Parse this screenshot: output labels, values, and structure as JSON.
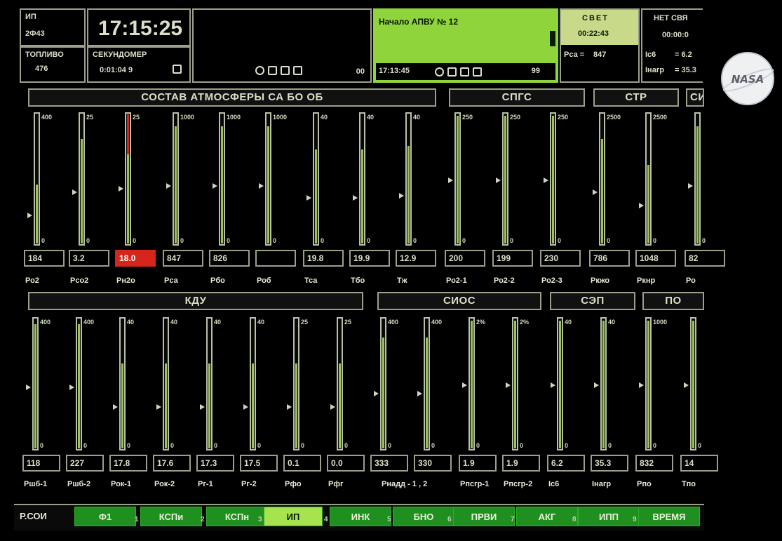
{
  "top": {
    "ip_label": "ИП",
    "ip_value": "2Ф43",
    "clock": "17:15:25",
    "fuel_label": "ТОПЛИВО",
    "fuel_value": "476",
    "stopwatch_label": "СЕКУНДОМЕР",
    "stopwatch_value": "0:01:04 9",
    "media1_counter": "00",
    "event_text": "Начало АПВУ № 12",
    "media2_time": "17:13:45",
    "media2_counter": "99",
    "light_label": "СВЕТ",
    "light_time": "00:22:43",
    "rca_label": "Рса  =",
    "rca_value": "847",
    "nolink_label": "НЕТ СВЯ",
    "nolink_time": "00:00:0",
    "ic6_label": "Iс6",
    "ic6_value": "= 6.2",
    "iagr_label": "Iнагр",
    "iagr_value": "= 35.3"
  },
  "logo": {
    "text": "NASA"
  },
  "sections_row1": [
    "СОСТАВ АТМОСФЕРЫ СА БО ОБ",
    "СПГС",
    "СТР",
    "СИ"
  ],
  "sections_row2": [
    "КДУ",
    "СИОС",
    "СЭП",
    "ПО"
  ],
  "row1_gauges": [
    {
      "max": "400",
      "fill": 0.45,
      "name": "Ро2",
      "value": "184"
    },
    {
      "max": "25",
      "fill": 0.8,
      "name": "Рсо2",
      "value": "3.2"
    },
    {
      "max": "25",
      "fill": 0.85,
      "name": "Рн2о",
      "value": "18.0",
      "alarm": true
    },
    {
      "max": "1000",
      "fill": 0.9,
      "name": "Рса",
      "value": "847"
    },
    {
      "max": "1000",
      "fill": 0.9,
      "name": "Рбо",
      "value": "826"
    },
    {
      "max": "1000",
      "fill": 0.9,
      "name": "Роб",
      "value": ""
    },
    {
      "max": "40",
      "fill": 0.72,
      "name": "Тса",
      "value": "19.8"
    },
    {
      "max": "40",
      "fill": 0.72,
      "name": "Тбо",
      "value": "19.9"
    },
    {
      "max": "40",
      "fill": 0.75,
      "name": "Тж",
      "value": "12.9"
    },
    {
      "max": "250",
      "fill": 0.98,
      "name": "Ро2-1",
      "value": "200"
    },
    {
      "max": "250",
      "fill": 0.98,
      "name": "Ро2-2",
      "value": "199"
    },
    {
      "max": "250",
      "fill": 0.98,
      "name": "Ро2-3",
      "value": "230"
    },
    {
      "max": "2500",
      "fill": 0.8,
      "name": "Ркжо",
      "value": "786"
    },
    {
      "max": "2500",
      "fill": 0.6,
      "name": "Ркнр",
      "value": "1048"
    },
    {
      "max": "",
      "fill": 0.9,
      "name": "Ро",
      "value": "82"
    }
  ],
  "row2_gauges": [
    {
      "max": "400",
      "fill": 0.95,
      "name": "Ршб-1",
      "value": "118"
    },
    {
      "max": "400",
      "fill": 0.95,
      "name": "Ршб-2",
      "value": "227"
    },
    {
      "max": "40",
      "fill": 0.65,
      "name": "Рок-1",
      "value": "17.8"
    },
    {
      "max": "40",
      "fill": 0.65,
      "name": "Рок-2",
      "value": "17.6"
    },
    {
      "max": "40",
      "fill": 0.65,
      "name": "Рг-1",
      "value": "17.3"
    },
    {
      "max": "40",
      "fill": 0.65,
      "name": "Рг-2",
      "value": "17.5"
    },
    {
      "max": "25",
      "fill": 0.65,
      "name": "Рфо",
      "value": "0.1"
    },
    {
      "max": "25",
      "fill": 0.65,
      "name": "Рфг",
      "value": "0.0"
    },
    {
      "max": "400",
      "fill": 0.85,
      "name": "",
      "value": "333"
    },
    {
      "max": "400",
      "fill": 0.85,
      "name": "",
      "value": "330"
    },
    {
      "max": "2%",
      "fill": 0.98,
      "name": "Рпсгр-1",
      "value": "1.9"
    },
    {
      "max": "2%",
      "fill": 0.98,
      "name": "Рпсгр-2",
      "value": "1.9"
    },
    {
      "max": "40",
      "fill": 0.98,
      "name": "Iс6",
      "value": "6.2"
    },
    {
      "max": "40",
      "fill": 0.98,
      "name": "Iнагр",
      "value": "35.3"
    },
    {
      "max": "1000",
      "fill": 0.98,
      "name": "Рпо",
      "value": "832"
    },
    {
      "max": "",
      "fill": 0.98,
      "name": "Тпо",
      "value": "14"
    }
  ],
  "rnadd_label": "Рнадд - 1 , 2",
  "bottom_bar": {
    "prefix": "Р.СОИ",
    "items": [
      "Ф1",
      "КСПи",
      "КСПн",
      "ИП",
      "ИНК",
      "БНО",
      "ПРВИ",
      "АКГ",
      "ИПП",
      "ВРЕМЯ"
    ],
    "nums": [
      "1",
      "2",
      "3",
      "4",
      "5",
      "6",
      "7",
      "8",
      "9"
    ],
    "active": "ИП"
  },
  "colors": {
    "accent_green": "#8fd43b",
    "bar_green": "#9cc25a",
    "alarm_red": "#d6261b",
    "button_green": "#1f8f1f"
  }
}
